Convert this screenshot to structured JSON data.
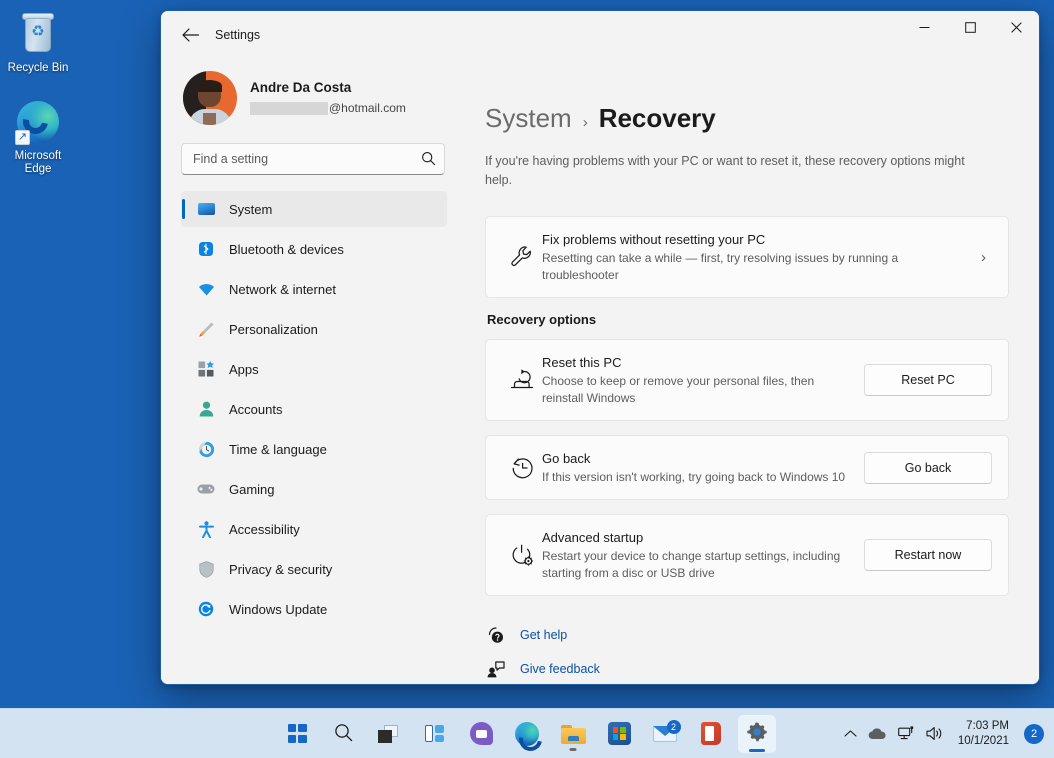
{
  "desktop": {
    "icons": [
      {
        "label": "Recycle Bin",
        "icon": "recycle-bin-icon"
      },
      {
        "label": "Microsoft\nEdge",
        "label_line1": "Microsoft",
        "label_line2": "Edge",
        "icon": "microsoft-edge-icon"
      }
    ],
    "background_color": "#1a62b5"
  },
  "window": {
    "title": "Settings",
    "back_tooltip": "Back",
    "controls": {
      "minimize": "—",
      "maximize": "□",
      "close": "✕"
    }
  },
  "sidebar": {
    "profile": {
      "name": "Andre Da Costa",
      "email_domain": "@hotmail.com",
      "email_redacted": true
    },
    "search": {
      "placeholder": "Find a setting",
      "value": ""
    },
    "items": [
      {
        "label": "System",
        "icon": "monitor-icon",
        "selected": true
      },
      {
        "label": "Bluetooth & devices",
        "icon": "bluetooth-icon",
        "selected": false
      },
      {
        "label": "Network & internet",
        "icon": "wifi-icon",
        "selected": false
      },
      {
        "label": "Personalization",
        "icon": "paintbrush-icon",
        "selected": false
      },
      {
        "label": "Apps",
        "icon": "apps-grid-icon",
        "selected": false
      },
      {
        "label": "Accounts",
        "icon": "person-icon",
        "selected": false
      },
      {
        "label": "Time & language",
        "icon": "clock-icon",
        "selected": false
      },
      {
        "label": "Gaming",
        "icon": "gamepad-icon",
        "selected": false
      },
      {
        "label": "Accessibility",
        "icon": "accessibility-icon",
        "selected": false
      },
      {
        "label": "Privacy & security",
        "icon": "shield-icon",
        "selected": false
      },
      {
        "label": "Windows Update",
        "icon": "update-refresh-icon",
        "selected": false
      }
    ]
  },
  "main": {
    "breadcrumb": {
      "parent": "System",
      "separator": "›",
      "current": "Recovery"
    },
    "intro": "If you're having problems with your PC or want to reset it, these recovery options might help.",
    "troubleshoot_card": {
      "title": "Fix problems without resetting your PC",
      "subtitle": "Resetting can take a while — first, try resolving issues by running a troubleshooter",
      "icon": "wrench-icon",
      "chevron": "›"
    },
    "section_heading": "Recovery options",
    "options": [
      {
        "title": "Reset this PC",
        "subtitle": "Choose to keep or remove your personal files, then reinstall Windows",
        "button": "Reset PC",
        "icon": "reset-pc-icon"
      },
      {
        "title": "Go back",
        "subtitle": "If this version isn't working, try going back to Windows 10",
        "button": "Go back",
        "icon": "history-clock-icon"
      },
      {
        "title": "Advanced startup",
        "subtitle": "Restart your device to change startup settings, including starting from a disc or USB drive",
        "button": "Restart now",
        "icon": "power-gear-icon"
      }
    ],
    "links": [
      {
        "label": "Get help",
        "icon": "help-question-icon"
      },
      {
        "label": "Give feedback",
        "icon": "feedback-icon"
      }
    ],
    "link_color": "#0a50a8"
  },
  "taskbar": {
    "background_color": "#d3e3f2",
    "buttons": [
      {
        "name": "start",
        "label": "Start",
        "icon": "windows-logo-icon",
        "state": "idle"
      },
      {
        "name": "search",
        "label": "Search",
        "icon": "search-icon",
        "state": "idle"
      },
      {
        "name": "task-view",
        "label": "Task View",
        "icon": "task-view-icon",
        "state": "idle"
      },
      {
        "name": "widgets",
        "label": "Widgets",
        "icon": "widgets-icon",
        "state": "idle"
      },
      {
        "name": "chat",
        "label": "Chat",
        "icon": "teams-chat-icon",
        "state": "idle"
      },
      {
        "name": "edge",
        "label": "Microsoft Edge",
        "icon": "microsoft-edge-icon",
        "state": "idle"
      },
      {
        "name": "file-explorer",
        "label": "File Explorer",
        "icon": "folder-icon",
        "state": "running"
      },
      {
        "name": "store",
        "label": "Microsoft Store",
        "icon": "microsoft-store-icon",
        "state": "idle"
      },
      {
        "name": "mail",
        "label": "Mail",
        "icon": "mail-icon",
        "state": "idle",
        "badge": "2"
      },
      {
        "name": "office",
        "label": "Office",
        "icon": "office-icon",
        "state": "idle"
      },
      {
        "name": "settings",
        "label": "Settings",
        "icon": "gear-icon",
        "state": "active"
      }
    ],
    "tray": {
      "overflow": "⌃",
      "items": [
        {
          "name": "onedrive",
          "icon": "cloud-icon"
        },
        {
          "name": "network",
          "icon": "network-icon"
        },
        {
          "name": "volume",
          "icon": "speaker-icon"
        }
      ],
      "time": "7:03 PM",
      "date": "10/1/2021",
      "notification_count": "2"
    }
  }
}
